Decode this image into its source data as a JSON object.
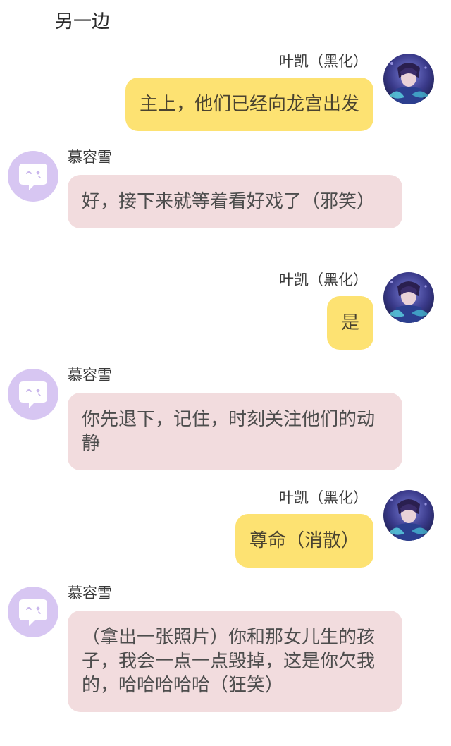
{
  "narration": "另一边",
  "messages": [
    {
      "side": "right",
      "sender": "叶凯（黑化）",
      "text": "主上，他们已经向龙宫出发"
    },
    {
      "side": "left",
      "sender": "慕容雪",
      "text": "好，接下来就等着看好戏了（邪笑）"
    },
    {
      "side": "right",
      "sender": "叶凯（黑化）",
      "text": "是"
    },
    {
      "side": "left",
      "sender": "慕容雪",
      "text": "你先退下，记住，时刻关注他们的动静"
    },
    {
      "side": "right",
      "sender": "叶凯（黑化）",
      "text": "尊命（消散）"
    },
    {
      "side": "left",
      "sender": "慕容雪",
      "text": "（拿出一张照片）你和那女儿生的孩子，我会一点一点毁掉，这是你欠我的，哈哈哈哈哈（狂笑）"
    }
  ],
  "colors": {
    "right_bubble": "#fde272",
    "left_bubble": "#f2dcde",
    "left_avatar": "#d7c6f2"
  }
}
